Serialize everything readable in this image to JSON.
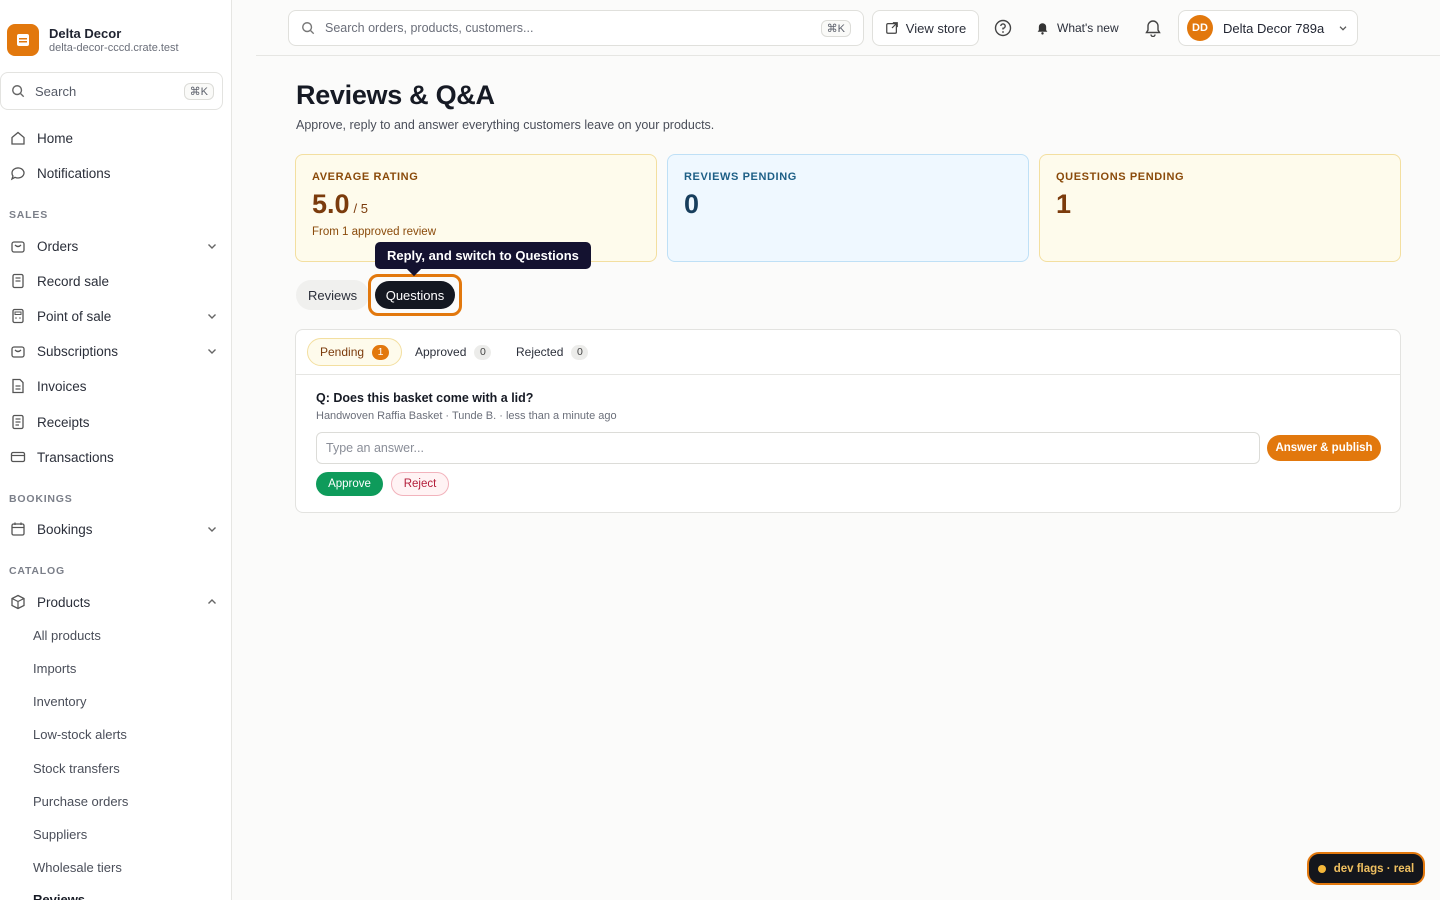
{
  "brand": {
    "name": "Delta Decor",
    "domain": "delta-decor-cccd.crate.test"
  },
  "sidebar": {
    "search_label": "Search",
    "search_shortcut": "⌘K",
    "top_items": [
      {
        "label": "Home",
        "icon": "home-icon"
      },
      {
        "label": "Notifications",
        "icon": "chat-bubble-icon"
      }
    ],
    "sections": {
      "sales": "SALES",
      "bookings": "BOOKINGS",
      "catalog": "CATALOG"
    },
    "sales_items": [
      {
        "label": "Orders",
        "icon": "bag-icon",
        "expandable": true
      },
      {
        "label": "Record sale",
        "icon": "receipt-icon",
        "expandable": false
      },
      {
        "label": "Point of sale",
        "icon": "calculator-icon",
        "expandable": true
      },
      {
        "label": "Subscriptions",
        "icon": "bag-icon",
        "expandable": true
      },
      {
        "label": "Invoices",
        "icon": "document-icon",
        "expandable": false
      },
      {
        "label": "Receipts",
        "icon": "receipt-icon",
        "expandable": false
      },
      {
        "label": "Transactions",
        "icon": "card-icon",
        "expandable": false
      }
    ],
    "bookings_items": [
      {
        "label": "Bookings",
        "icon": "calendar-icon",
        "expandable": true
      }
    ],
    "catalog_items": [
      {
        "label": "Products",
        "icon": "box-icon",
        "expanded": true
      }
    ],
    "product_subitems": [
      "All products",
      "Imports",
      "Inventory",
      "Low-stock alerts",
      "Stock transfers",
      "Purchase orders",
      "Suppliers",
      "Wholesale tiers",
      "Reviews"
    ]
  },
  "topbar": {
    "search_placeholder": "Search orders, products, customers...",
    "search_shortcut": "⌘K",
    "view_store": "View store",
    "whats_new": "What's new",
    "account_initials": "DD",
    "account_name": "Delta Decor 789a"
  },
  "page": {
    "title": "Reviews & Q&A",
    "subtitle": "Approve, reply to and answer everything customers leave on your products."
  },
  "stats": {
    "rating": {
      "label": "AVERAGE RATING",
      "value": "5.0",
      "unit": "/ 5",
      "foot": "From 1 approved review"
    },
    "reviews_pending": {
      "label": "REVIEWS PENDING",
      "value": "0"
    },
    "questions_pending": {
      "label": "QUESTIONS PENDING",
      "value": "1"
    }
  },
  "tooltip": "Reply, and switch to Questions",
  "tabs": {
    "reviews": "Reviews",
    "questions": "Questions",
    "active": "questions"
  },
  "subtabs": [
    {
      "label": "Pending",
      "count": "1",
      "active": true
    },
    {
      "label": "Approved",
      "count": "0",
      "active": false
    },
    {
      "label": "Rejected",
      "count": "0",
      "active": false
    }
  ],
  "question": {
    "text": "Q: Does this basket come with a lid?",
    "meta": "Handwoven Raffia Basket · Tunde B. · less than a minute ago",
    "answer_placeholder": "Type an answer...",
    "answer_button": "Answer & publish",
    "approve": "Approve",
    "reject": "Reject"
  },
  "dev_flags": "dev flags · real",
  "colors": {
    "accent": "#e2780d",
    "dark": "#141821",
    "approve": "#0e9b5b",
    "reject": "#b31e3a"
  }
}
